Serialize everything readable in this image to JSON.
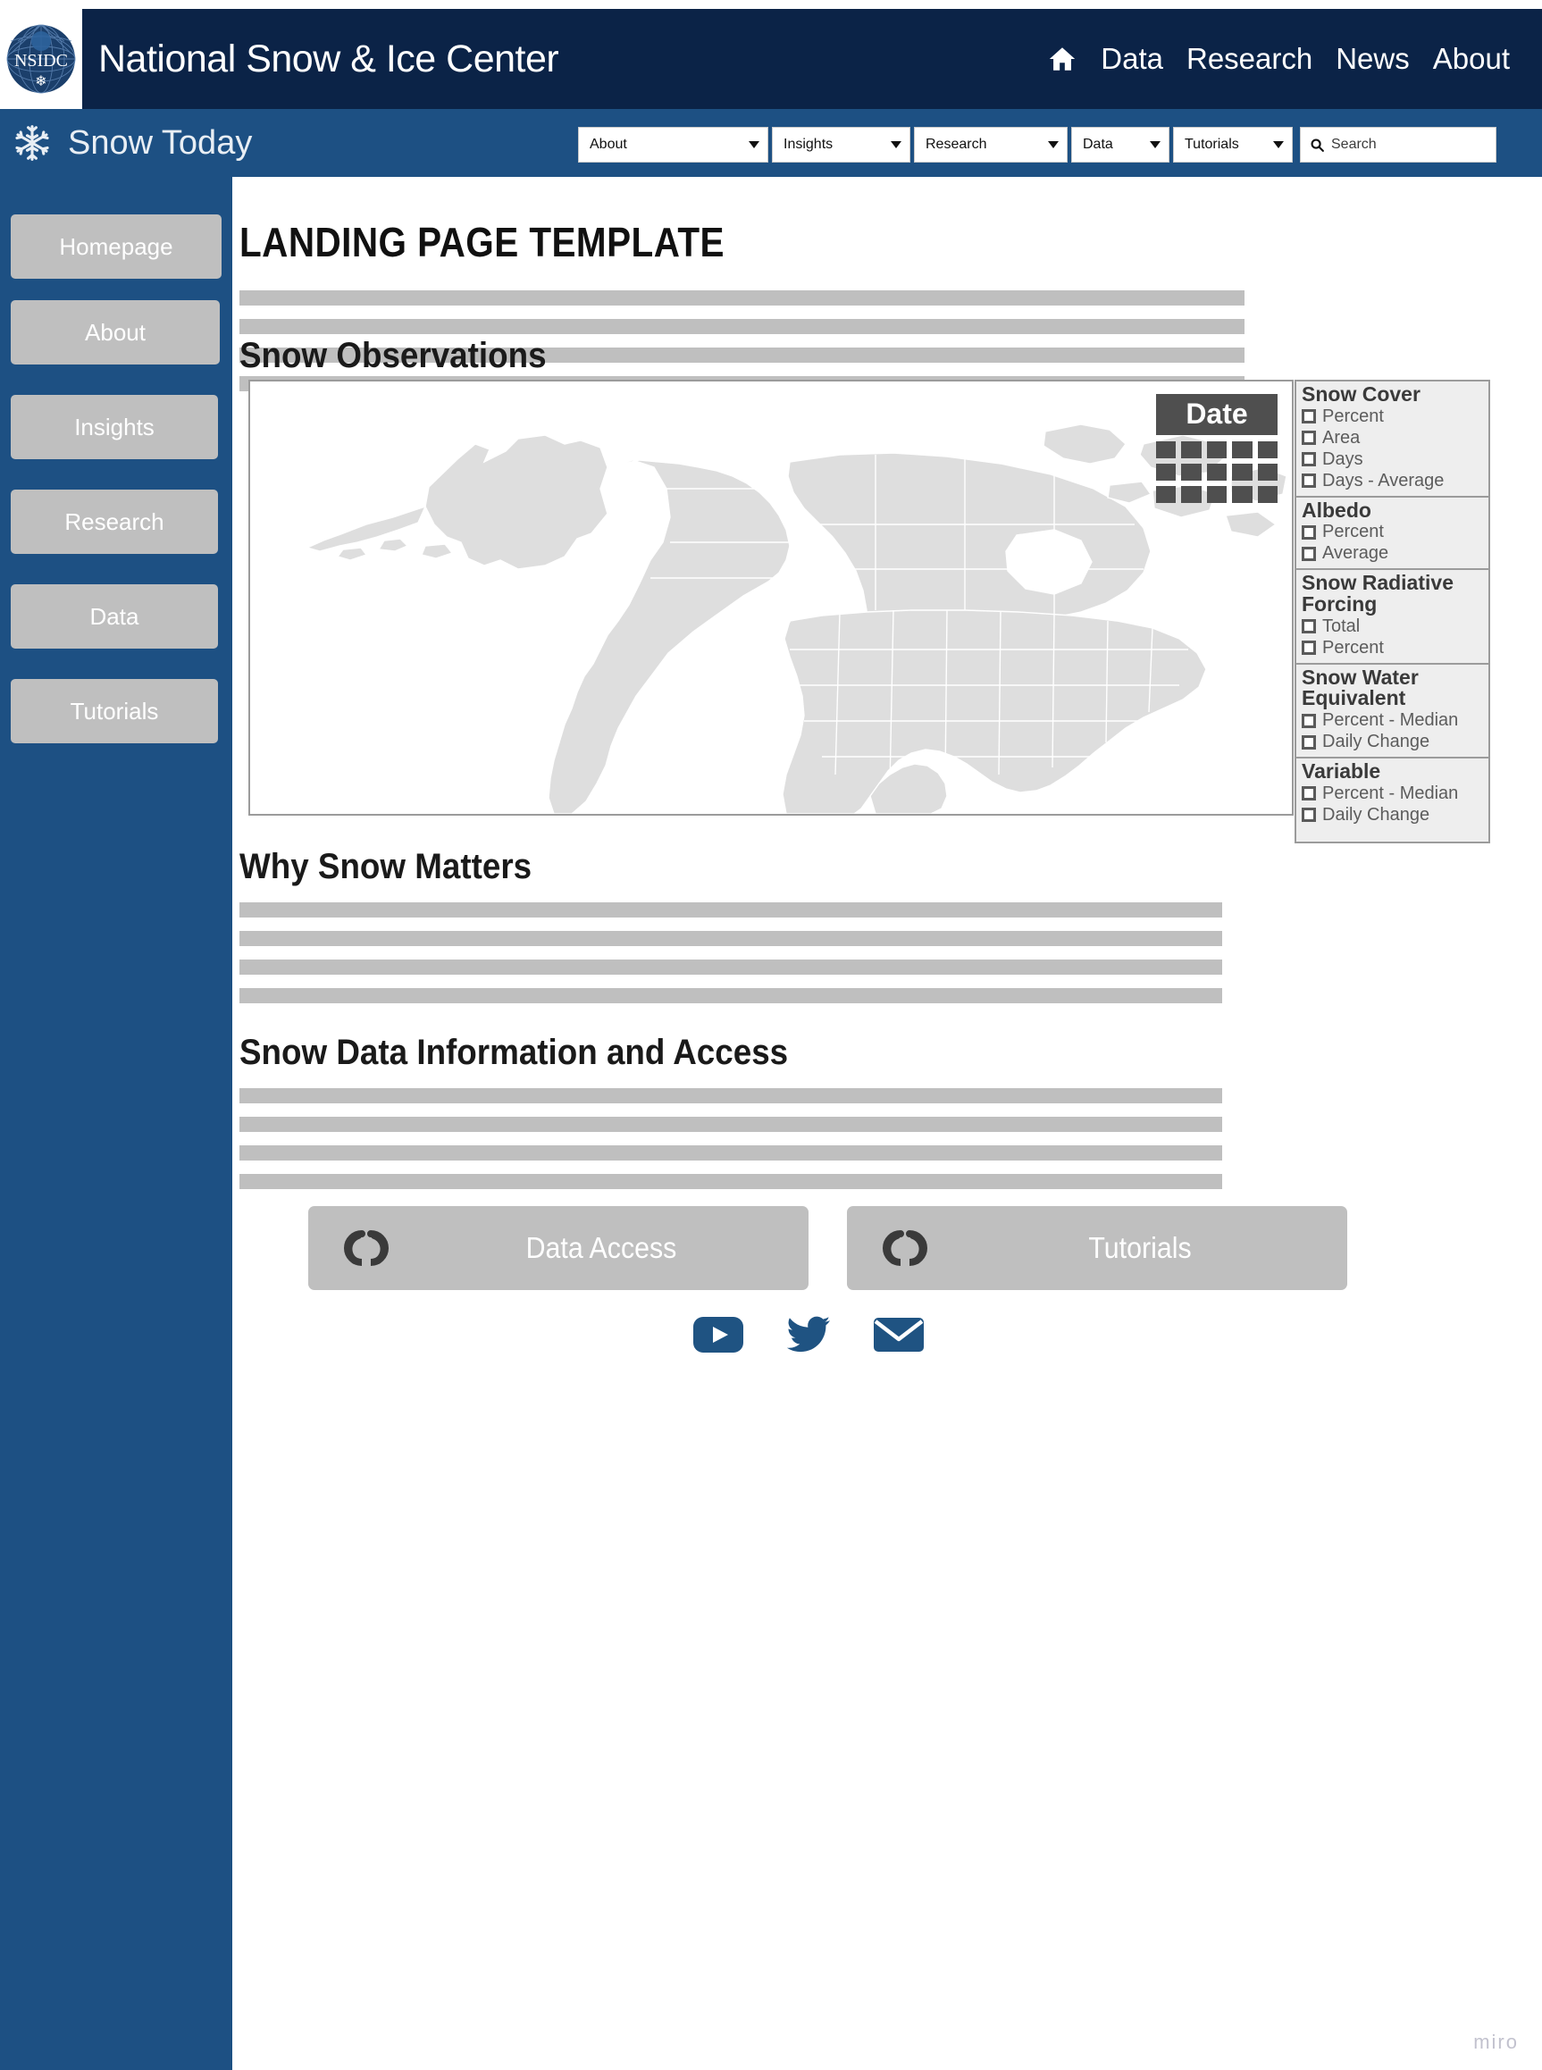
{
  "header": {
    "org_title": "National Snow & Ice Center",
    "logo_text": "NSIDC",
    "home_icon": "home-icon",
    "nav": [
      {
        "label": "Data"
      },
      {
        "label": "Research"
      },
      {
        "label": "News"
      },
      {
        "label": "About"
      }
    ]
  },
  "subheader": {
    "title": "Snow Today",
    "icon": "snowflake-icon",
    "menus": [
      {
        "label": "About"
      },
      {
        "label": "Insights"
      },
      {
        "label": "Research"
      },
      {
        "label": "Data"
      },
      {
        "label": "Tutorials"
      }
    ],
    "search": {
      "icon": "search-icon",
      "placeholder": "Search",
      "value": ""
    }
  },
  "sidebar": {
    "items": [
      {
        "label": "Homepage"
      },
      {
        "label": "About"
      },
      {
        "label": "Insights"
      },
      {
        "label": "Research"
      },
      {
        "label": "Data"
      },
      {
        "label": "Tutorials"
      }
    ]
  },
  "main": {
    "page_title": "LANDING PAGE TEMPLATE",
    "sections": [
      {
        "heading": "Snow Observations"
      },
      {
        "heading": "Why Snow Matters"
      },
      {
        "heading": "Snow Data Information and Access"
      }
    ]
  },
  "map_panel": {
    "date_widget": {
      "title": "Date",
      "icon": "calendar-icon",
      "cells": 15
    },
    "map": {
      "icon": "north-america-map",
      "fill_color": "#dedede"
    },
    "checkbox_groups": [
      {
        "title": "Snow Cover",
        "options": [
          {
            "label": "Percent",
            "checked": false
          },
          {
            "label": "Area",
            "checked": false
          },
          {
            "label": "Days",
            "checked": false
          },
          {
            "label": "Days - Average",
            "checked": false
          }
        ]
      },
      {
        "title": "Albedo",
        "options": [
          {
            "label": "Percent",
            "checked": false
          },
          {
            "label": "Average",
            "checked": false
          }
        ]
      },
      {
        "title": "Snow Radiative Forcing",
        "options": [
          {
            "label": "Total",
            "checked": false
          },
          {
            "label": "Percent",
            "checked": false
          }
        ]
      },
      {
        "title": "Snow Water Equivalent",
        "options": [
          {
            "label": "Percent - Median",
            "checked": false
          },
          {
            "label": "Daily Change",
            "checked": false
          }
        ]
      },
      {
        "title": "Variable",
        "options": [
          {
            "label": "Percent - Median",
            "checked": false
          },
          {
            "label": "Daily Change",
            "checked": false
          }
        ]
      }
    ]
  },
  "cta": {
    "buttons": [
      {
        "label": "Data Access",
        "icon": "link-chain-icon"
      },
      {
        "label": "Tutorials",
        "icon": "link-chain-icon"
      }
    ]
  },
  "social": [
    {
      "name": "youtube-icon"
    },
    {
      "name": "twitter-icon"
    },
    {
      "name": "email-icon"
    }
  ],
  "watermark": "miro",
  "colors": {
    "nsidc_navy": "#0b2347",
    "snow_blue": "#1d5083",
    "placeholder_gray": "#bfbfbf",
    "panel_gray": "#eeeeee",
    "social_blue": "#1f5382"
  }
}
